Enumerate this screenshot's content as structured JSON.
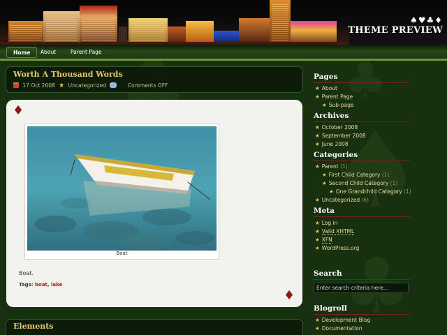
{
  "header": {
    "suits": "♠♥♣♦",
    "title": "THEME PREVIEW"
  },
  "nav": [
    {
      "label": "Home",
      "active": true
    },
    {
      "label": "About"
    },
    {
      "label": "Parent Page"
    }
  ],
  "post": {
    "title": "Worth A Thousand Words",
    "date": "17 Oct 2008",
    "category": "Uncategorized",
    "comments": "Comments OFF",
    "image_caption": "Boat",
    "excerpt": "Boat.",
    "tags_label": "Tags:",
    "tags": [
      "boat",
      "lake"
    ]
  },
  "post2": {
    "title": "Elements"
  },
  "sidebar": {
    "pages": {
      "title": "Pages",
      "items": [
        "About",
        "Parent Page",
        "Sub-page"
      ]
    },
    "archives": {
      "title": "Archives",
      "items": [
        "October 2008",
        "September 2008",
        "June 2008"
      ]
    },
    "categories": {
      "title": "Categories",
      "items": [
        {
          "label": "Parent",
          "count": "(1)"
        },
        {
          "label": "First Child Category",
          "count": "(1)"
        },
        {
          "label": "Second Child Category",
          "count": "(1)"
        },
        {
          "label": "One Grandchild Category",
          "count": "(1)"
        },
        {
          "label": "Uncategorized",
          "count": "(6)"
        }
      ]
    },
    "meta": {
      "title": "Meta",
      "items": [
        "Log in",
        "Valid XHTML",
        "XFN",
        "WordPress.org"
      ]
    },
    "search": {
      "title": "Search",
      "placeholder": "Enter search criteria here..."
    },
    "blogroll": {
      "title": "Blogroll",
      "items": [
        "Development Blog",
        "Documentation"
      ]
    }
  },
  "colors": {
    "accent_gold": "#e3c869",
    "card_red": "#8b1a1a",
    "background": "#17300f"
  }
}
